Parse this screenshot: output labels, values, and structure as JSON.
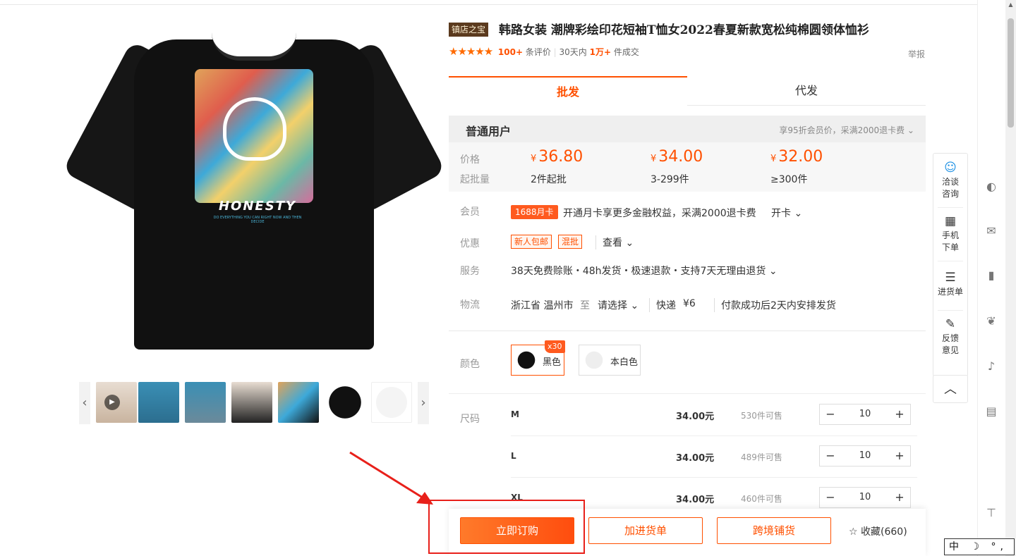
{
  "product": {
    "badge": "镇店之宝",
    "title": "韩路女装 潮牌彩绘印花短袖T恤女2022春夏新款宽松纯棉圆领体恤衫",
    "rating_stars": "★★★★★",
    "review_count": "100+",
    "review_label": "条评价",
    "sales_period": "30天内",
    "sales_count": "1万+",
    "sales_label": "件成交",
    "report": "举报",
    "print_text": "HONESTY",
    "print_sub": "DO EVERYTHING YOU CAN RIGHT NOW AND THEN DECIDE"
  },
  "tabs": [
    "批发",
    "代发"
  ],
  "pricing": {
    "title": "普通用户",
    "note": "享95折会员价，采满2000退卡费 ⌄",
    "price_label": "价格",
    "qty_label": "起批量",
    "currency": "¥",
    "tiers": [
      {
        "price": "36.80",
        "qty": "2件起批"
      },
      {
        "price": "34.00",
        "qty": "3-299件"
      },
      {
        "price": "32.00",
        "qty": "≥300件"
      }
    ]
  },
  "member": {
    "label": "会员",
    "card": "1688月卡",
    "text": "开通月卡享更多金融权益，采满2000退卡费",
    "action": "开卡 ⌄"
  },
  "promo": {
    "label": "优惠",
    "tags": [
      "新人包邮",
      "混批"
    ],
    "view": "查看 ⌄"
  },
  "service": {
    "label": "服务",
    "text": "38天免费赊账・48h发货・极速退款・支持7天无理由退货 ⌄"
  },
  "logistics": {
    "label": "物流",
    "from": "浙江省 温州市",
    "to_word": "至",
    "select": "请选择 ⌄",
    "express": "快递",
    "fee": "¥6",
    "ship": "付款成功后2天内安排发货"
  },
  "color": {
    "label": "颜色",
    "badge": "x30",
    "options": [
      "黑色",
      "本白色"
    ]
  },
  "size": {
    "label": "尺码",
    "rows": [
      {
        "size": "M",
        "price": "34.00元",
        "stock": "530件可售",
        "qty": "10"
      },
      {
        "size": "L",
        "price": "34.00元",
        "stock": "489件可售",
        "qty": "10"
      },
      {
        "size": "XL",
        "price": "34.00元",
        "stock": "460件可售",
        "qty": "10"
      }
    ]
  },
  "actions": {
    "buy": "立即订购",
    "cart": "加进货单",
    "crossborder": "跨境铺货",
    "fav": "收藏(660)"
  },
  "tools": [
    {
      "icon": "chat-icon",
      "label1": "洽谈",
      "label2": "咨询"
    },
    {
      "icon": "qrcode-icon",
      "label1": "手机",
      "label2": "下单"
    },
    {
      "icon": "list-icon",
      "label1": "进货单",
      "label2": ""
    },
    {
      "icon": "edit-icon",
      "label1": "反馈",
      "label2": "意见"
    }
  ],
  "ime": "中 ☽ °,",
  "colors": {
    "accent": "#ff5000",
    "highlight_box": "#e8201a"
  }
}
